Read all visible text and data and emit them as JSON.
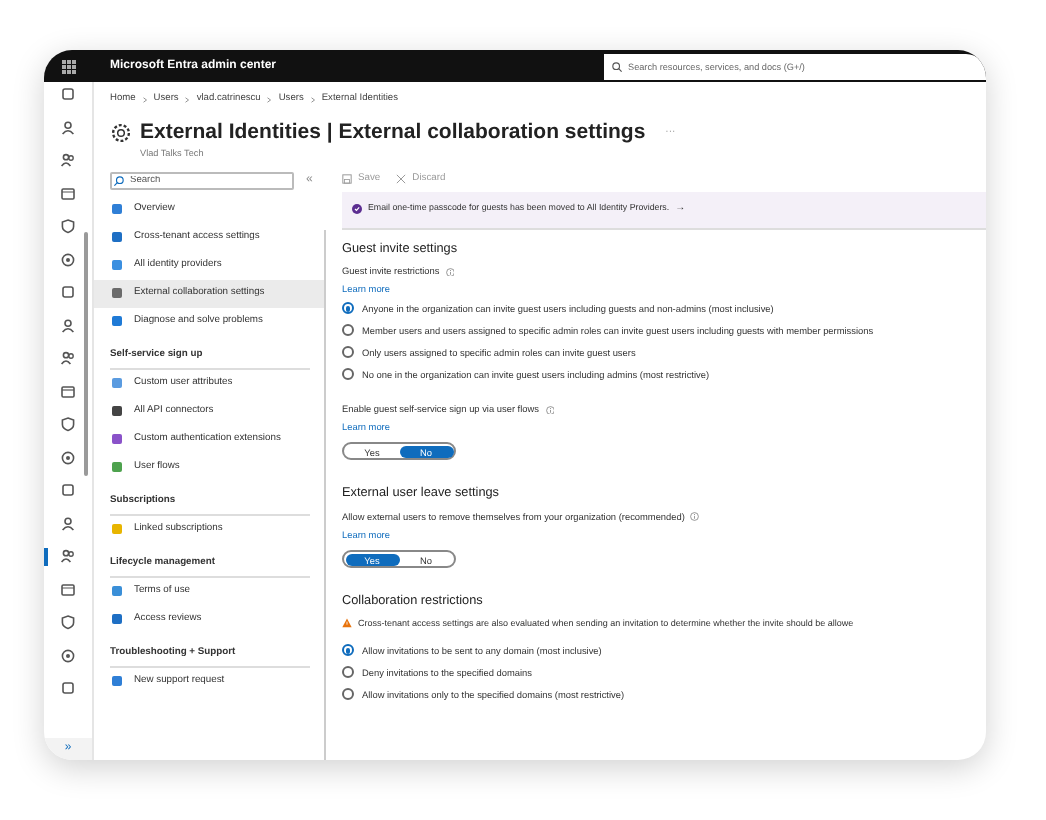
{
  "top_bar": {
    "title": "Microsoft Entra admin center",
    "search_placeholder": "Search resources, services, and docs (G+/)"
  },
  "rail": [
    {
      "selected": false
    },
    {
      "selected": false
    },
    {
      "selected": false
    },
    {
      "selected": false
    },
    {
      "selected": false
    },
    {
      "selected": false
    },
    {
      "selected": false
    },
    {
      "selected": false
    },
    {
      "selected": false
    },
    {
      "selected": false
    },
    {
      "selected": false
    },
    {
      "selected": false
    },
    {
      "selected": false
    },
    {
      "selected": false
    },
    {
      "selected": true
    },
    {
      "selected": false
    },
    {
      "selected": false
    },
    {
      "selected": false
    },
    {
      "selected": false
    }
  ],
  "rail_expand": "»",
  "breadcrumb": [
    "Home",
    "Users",
    "vlad.catrinescu",
    "Users",
    "External Identities"
  ],
  "page": {
    "title": "External Identities | External collaboration settings",
    "more": "···",
    "subtitle": "Vlad Talks Tech"
  },
  "sidebar": {
    "search_placeholder": "Search",
    "collapse": "«",
    "sections": [
      {
        "items": [
          {
            "label": "Overview",
            "color": "#2f7fd6",
            "selected": false
          },
          {
            "label": "Cross-tenant access settings",
            "color": "#1e6fc4",
            "selected": false
          },
          {
            "label": "All identity providers",
            "color": "#3b8fe0",
            "selected": false
          },
          {
            "label": "External collaboration settings",
            "color": "#6b6b6b",
            "selected": true
          },
          {
            "label": "Diagnose and solve problems",
            "color": "#1f7ad6",
            "selected": false
          }
        ]
      },
      {
        "heading": "Self-service sign up",
        "items": [
          {
            "label": "Custom user attributes",
            "color": "#5a9be0",
            "selected": false
          },
          {
            "label": "All API connectors",
            "color": "#444444",
            "selected": false
          },
          {
            "label": "Custom authentication extensions",
            "color": "#8a52c9",
            "selected": false
          },
          {
            "label": "User flows",
            "color": "#4ea24e",
            "selected": false
          }
        ]
      },
      {
        "heading": "Subscriptions",
        "items": [
          {
            "label": "Linked subscriptions",
            "color": "#e8b500",
            "selected": false
          }
        ]
      },
      {
        "heading": "Lifecycle management",
        "items": [
          {
            "label": "Terms of use",
            "color": "#3a8fd8",
            "selected": false
          },
          {
            "label": "Access reviews",
            "color": "#1e6fc4",
            "selected": false
          }
        ]
      },
      {
        "heading": "Troubleshooting + Support",
        "items": [
          {
            "label": "New support request",
            "color": "#2f7fd6",
            "selected": false
          }
        ]
      }
    ]
  },
  "toolbar": [
    {
      "label": "Save",
      "disabled": true
    },
    {
      "label": "Discard",
      "disabled": true
    }
  ],
  "banner": {
    "text": "Email one-time passcode for guests has been moved to All Identity Providers.",
    "arrow": "→"
  },
  "guest_invite": {
    "heading": "Guest invite settings",
    "label": "Guest invite restrictions",
    "learn_more": "Learn more",
    "options": [
      {
        "label": "Anyone in the organization can invite guest users including guests and non-admins (most inclusive)",
        "selected": true
      },
      {
        "label": "Member users and users assigned to specific admin roles can invite guest users including guests with member permissions",
        "selected": false
      },
      {
        "label": "Only users assigned to specific admin roles can invite guest users",
        "selected": false
      },
      {
        "label": "No one in the organization can invite guest users including admins (most restrictive)",
        "selected": false
      }
    ],
    "self_service": {
      "label": "Enable guest self-service sign up via user flows",
      "learn_more": "Learn more",
      "options": [
        {
          "label": "Yes",
          "selected": false
        },
        {
          "label": "No",
          "selected": true
        }
      ]
    }
  },
  "leave": {
    "heading": "External user leave settings",
    "label": "Allow external users to remove themselves from your organization (recommended)",
    "learn_more": "Learn more",
    "options": [
      {
        "label": "Yes",
        "selected": true
      },
      {
        "label": "No",
        "selected": false
      }
    ]
  },
  "collab": {
    "heading": "Collaboration restrictions",
    "warning": "Cross-tenant access settings are also evaluated when sending an invitation to determine whether the invite should be allowe",
    "options": [
      {
        "label": "Allow invitations to be sent to any domain (most inclusive)",
        "selected": true
      },
      {
        "label": "Deny invitations to the specified domains",
        "selected": false
      },
      {
        "label": "Allow invitations only to the specified domains (most restrictive)",
        "selected": false
      }
    ]
  }
}
